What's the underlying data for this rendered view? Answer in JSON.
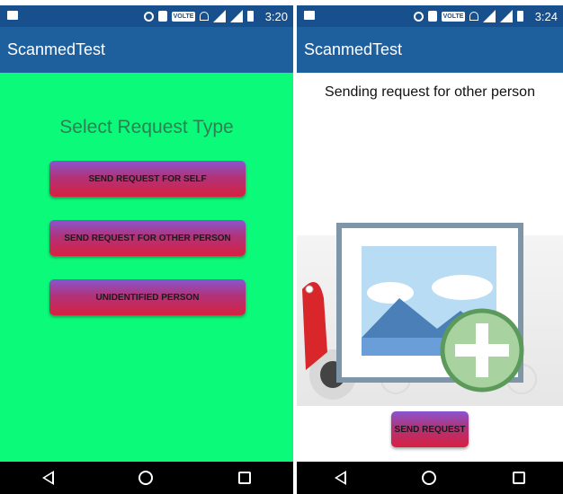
{
  "left": {
    "status_time": "3:20",
    "volte_label": "VOLTE",
    "app_title": "ScanmedTest",
    "select_title": "Select Request Type",
    "buttons": {
      "self": "SEND REQUEST FOR SELF",
      "other": "SEND REQUEST FOR OTHER PERSON",
      "unidentified": "UNIDENTIFIED PERSON"
    }
  },
  "right": {
    "status_time": "3:24",
    "volte_label": "VOLTE",
    "app_title": "ScanmedTest",
    "heading": "Sending request for other person",
    "send_button": "SEND REQUEST"
  },
  "colors": {
    "app_bar": "#1e5f9e",
    "status_bar": "#17508d",
    "left_background": "#0cfa79",
    "button_top": "#8a55d0",
    "button_bottom": "#d72040"
  },
  "icons": [
    "notification-icon",
    "hotspot-icon",
    "vibrate-icon",
    "volte-icon",
    "wifi-icon",
    "signal-icon",
    "battery-icon",
    "image-placeholder-icon",
    "add-icon",
    "back-icon",
    "home-icon",
    "recents-icon"
  ]
}
